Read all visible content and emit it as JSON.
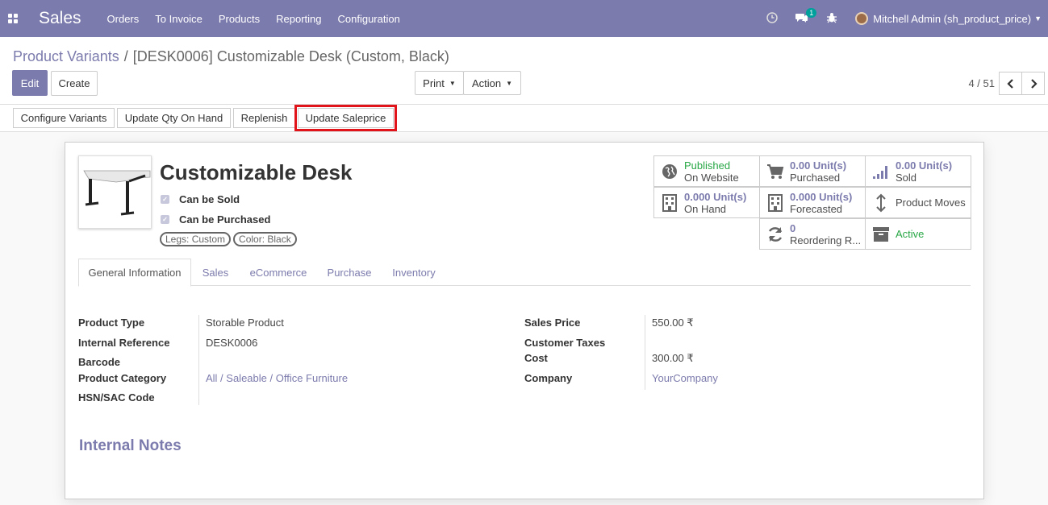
{
  "navbar": {
    "app_name": "Sales",
    "menu": [
      "Orders",
      "To Invoice",
      "Products",
      "Reporting",
      "Configuration"
    ],
    "message_badge": "1",
    "user": "Mitchell Admin (sh_product_price)",
    "bg_color": "#7c7bad"
  },
  "breadcrumb": {
    "parent": "Product Variants",
    "current": "[DESK0006] Customizable Desk (Custom, Black)"
  },
  "toolbar": {
    "edit": "Edit",
    "create": "Create",
    "print": "Print",
    "action": "Action",
    "pager": "4 / 51"
  },
  "header_buttons": {
    "configure_variants": "Configure Variants",
    "update_qty": "Update Qty On Hand",
    "replenish": "Replenish",
    "update_saleprice": "Update Saleprice"
  },
  "product": {
    "name": "Customizable Desk",
    "can_be_sold": "Can be Sold",
    "can_be_purchased": "Can be Purchased",
    "tags": [
      "Legs: Custom",
      "Color: Black"
    ]
  },
  "smart_buttons": {
    "website_status": "Published",
    "website_label": "On Website",
    "purchased_value": "0.00 Unit(s)",
    "purchased_label": "Purchased",
    "sold_value": "0.00 Unit(s)",
    "sold_label": "Sold",
    "onhand_value": "0.000 Unit(s)",
    "onhand_label": "On Hand",
    "forecast_value": "0.000 Unit(s)",
    "forecast_label": "Forecasted",
    "moves_label": "Product Moves",
    "reorder_value": "0",
    "reorder_label": "Reordering R...",
    "active_label": "Active"
  },
  "tabs": [
    "General Information",
    "Sales",
    "eCommerce",
    "Purchase",
    "Inventory"
  ],
  "general": {
    "product_type_label": "Product Type",
    "product_type": "Storable Product",
    "internal_ref_label": "Internal Reference",
    "internal_ref": "DESK0006",
    "barcode_label": "Barcode",
    "category_label": "Product Category",
    "category": "All / Saleable / Office Furniture",
    "hsn_label": "HSN/SAC Code",
    "sales_price_label": "Sales Price",
    "sales_price": "550.00 ₹",
    "customer_taxes_label": "Customer Taxes",
    "cost_label": "Cost",
    "cost": "300.00 ₹",
    "company_label": "Company",
    "company": "YourCompany"
  },
  "internal_notes_title": "Internal Notes"
}
